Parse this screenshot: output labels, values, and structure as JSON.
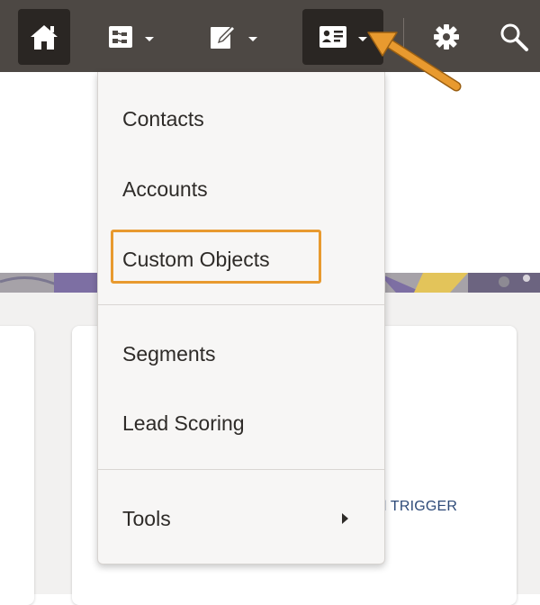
{
  "toolbar": {
    "buttons": [
      {
        "name": "home",
        "icon": "home-icon"
      },
      {
        "name": "campaigns",
        "icon": "campaigns-icon",
        "has_dropdown": true
      },
      {
        "name": "assets",
        "icon": "pencil-icon",
        "has_dropdown": true
      },
      {
        "name": "contacts",
        "icon": "contact-card-icon",
        "has_dropdown": true,
        "active": true
      },
      {
        "name": "settings",
        "icon": "gear-icon"
      },
      {
        "name": "search",
        "icon": "search-icon"
      }
    ]
  },
  "menu": {
    "items": [
      {
        "label": "Contacts"
      },
      {
        "label": "Accounts"
      },
      {
        "label": "Custom Objects",
        "highlighted": true
      },
      {
        "label": "Segments"
      },
      {
        "label": "Lead Scoring"
      },
      {
        "label": "Tools",
        "has_submenu": true
      }
    ]
  },
  "background": {
    "trigger_link": "il TRIGGER"
  },
  "colors": {
    "toolbar_bg": "#4d4844",
    "active_button_bg": "#2a2623",
    "menu_bg": "#f7f6f5",
    "highlight": "#e89a2f",
    "callout_arrow": "#e89a2f",
    "link": "#2d4a78"
  }
}
